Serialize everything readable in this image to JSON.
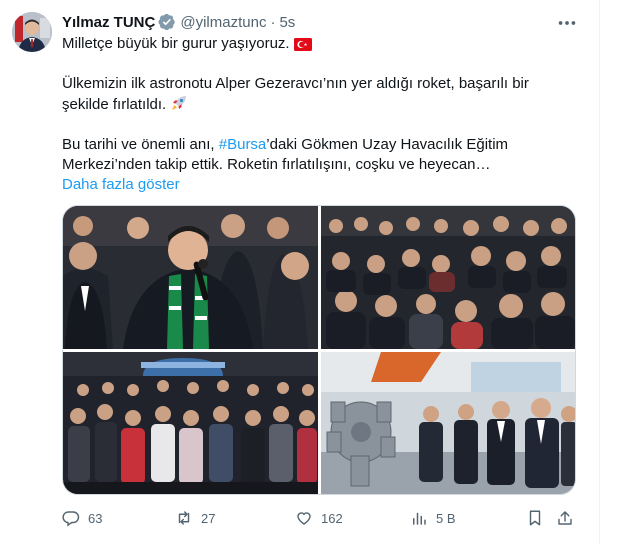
{
  "tweet": {
    "author_name": "Yılmaz TUNÇ",
    "handle": "@yilmaztunc",
    "separator": "·",
    "time": "5s",
    "line1": "Milletçe büyük bir gurur yaşıyoruz.",
    "line2": "Ülkemizin ilk astronotu Alper Gezeravcı’nın yer aldığı roket, başarılı bir",
    "line3": "şekilde fırlatıldı.",
    "line4_pre": "Bu tarihi ve önemli anı, ",
    "hashtag": "#Bursa",
    "line4_post": "’daki Gökmen Uzay Havacılık Eğitim",
    "line5": "Merkezi’nden takip ettik. Roketin fırlatılışını, coşku ve heyecan…",
    "show_more": "Daha fazla göster"
  },
  "icons": {
    "verified": "verified-badge-icon",
    "more": "more-icon",
    "flag": "turkey-flag-icon",
    "rocket": "rocket-icon",
    "reply": "reply-icon",
    "retweet": "retweet-icon",
    "like": "like-icon",
    "views": "views-icon",
    "bookmark": "bookmark-icon",
    "share": "share-icon"
  },
  "metrics": {
    "replies": "63",
    "retweets": "27",
    "likes": "162",
    "views": "5 B"
  },
  "colors": {
    "text": "#0f1419",
    "secondary": "#536471",
    "link": "#1d9bf0",
    "verified": "#829aab",
    "flag_red": "#e30a17"
  }
}
